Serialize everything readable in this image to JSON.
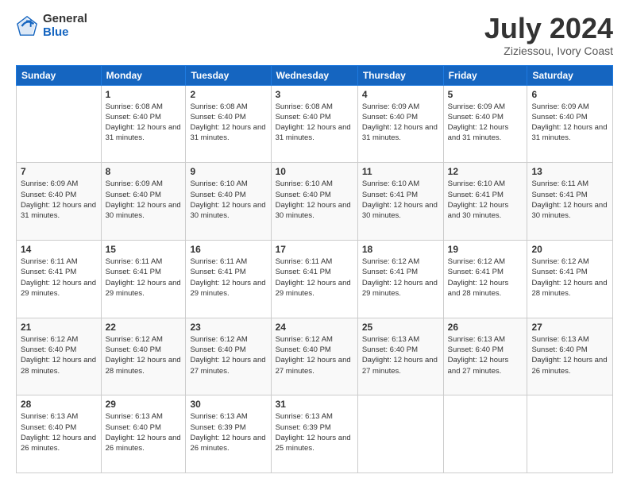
{
  "logo": {
    "general": "General",
    "blue": "Blue"
  },
  "title": {
    "month_year": "July 2024",
    "location": "Ziziessou, Ivory Coast"
  },
  "weekdays": [
    "Sunday",
    "Monday",
    "Tuesday",
    "Wednesday",
    "Thursday",
    "Friday",
    "Saturday"
  ],
  "weeks": [
    [
      {
        "day": "",
        "sunrise": "",
        "sunset": "",
        "daylight": ""
      },
      {
        "day": "1",
        "sunrise": "Sunrise: 6:08 AM",
        "sunset": "Sunset: 6:40 PM",
        "daylight": "Daylight: 12 hours and 31 minutes."
      },
      {
        "day": "2",
        "sunrise": "Sunrise: 6:08 AM",
        "sunset": "Sunset: 6:40 PM",
        "daylight": "Daylight: 12 hours and 31 minutes."
      },
      {
        "day": "3",
        "sunrise": "Sunrise: 6:08 AM",
        "sunset": "Sunset: 6:40 PM",
        "daylight": "Daylight: 12 hours and 31 minutes."
      },
      {
        "day": "4",
        "sunrise": "Sunrise: 6:09 AM",
        "sunset": "Sunset: 6:40 PM",
        "daylight": "Daylight: 12 hours and 31 minutes."
      },
      {
        "day": "5",
        "sunrise": "Sunrise: 6:09 AM",
        "sunset": "Sunset: 6:40 PM",
        "daylight": "Daylight: 12 hours and 31 minutes."
      },
      {
        "day": "6",
        "sunrise": "Sunrise: 6:09 AM",
        "sunset": "Sunset: 6:40 PM",
        "daylight": "Daylight: 12 hours and 31 minutes."
      }
    ],
    [
      {
        "day": "7",
        "sunrise": "Sunrise: 6:09 AM",
        "sunset": "Sunset: 6:40 PM",
        "daylight": "Daylight: 12 hours and 31 minutes."
      },
      {
        "day": "8",
        "sunrise": "Sunrise: 6:09 AM",
        "sunset": "Sunset: 6:40 PM",
        "daylight": "Daylight: 12 hours and 30 minutes."
      },
      {
        "day": "9",
        "sunrise": "Sunrise: 6:10 AM",
        "sunset": "Sunset: 6:40 PM",
        "daylight": "Daylight: 12 hours and 30 minutes."
      },
      {
        "day": "10",
        "sunrise": "Sunrise: 6:10 AM",
        "sunset": "Sunset: 6:40 PM",
        "daylight": "Daylight: 12 hours and 30 minutes."
      },
      {
        "day": "11",
        "sunrise": "Sunrise: 6:10 AM",
        "sunset": "Sunset: 6:41 PM",
        "daylight": "Daylight: 12 hours and 30 minutes."
      },
      {
        "day": "12",
        "sunrise": "Sunrise: 6:10 AM",
        "sunset": "Sunset: 6:41 PM",
        "daylight": "Daylight: 12 hours and 30 minutes."
      },
      {
        "day": "13",
        "sunrise": "Sunrise: 6:11 AM",
        "sunset": "Sunset: 6:41 PM",
        "daylight": "Daylight: 12 hours and 30 minutes."
      }
    ],
    [
      {
        "day": "14",
        "sunrise": "Sunrise: 6:11 AM",
        "sunset": "Sunset: 6:41 PM",
        "daylight": "Daylight: 12 hours and 29 minutes."
      },
      {
        "day": "15",
        "sunrise": "Sunrise: 6:11 AM",
        "sunset": "Sunset: 6:41 PM",
        "daylight": "Daylight: 12 hours and 29 minutes."
      },
      {
        "day": "16",
        "sunrise": "Sunrise: 6:11 AM",
        "sunset": "Sunset: 6:41 PM",
        "daylight": "Daylight: 12 hours and 29 minutes."
      },
      {
        "day": "17",
        "sunrise": "Sunrise: 6:11 AM",
        "sunset": "Sunset: 6:41 PM",
        "daylight": "Daylight: 12 hours and 29 minutes."
      },
      {
        "day": "18",
        "sunrise": "Sunrise: 6:12 AM",
        "sunset": "Sunset: 6:41 PM",
        "daylight": "Daylight: 12 hours and 29 minutes."
      },
      {
        "day": "19",
        "sunrise": "Sunrise: 6:12 AM",
        "sunset": "Sunset: 6:41 PM",
        "daylight": "Daylight: 12 hours and 28 minutes."
      },
      {
        "day": "20",
        "sunrise": "Sunrise: 6:12 AM",
        "sunset": "Sunset: 6:41 PM",
        "daylight": "Daylight: 12 hours and 28 minutes."
      }
    ],
    [
      {
        "day": "21",
        "sunrise": "Sunrise: 6:12 AM",
        "sunset": "Sunset: 6:40 PM",
        "daylight": "Daylight: 12 hours and 28 minutes."
      },
      {
        "day": "22",
        "sunrise": "Sunrise: 6:12 AM",
        "sunset": "Sunset: 6:40 PM",
        "daylight": "Daylight: 12 hours and 28 minutes."
      },
      {
        "day": "23",
        "sunrise": "Sunrise: 6:12 AM",
        "sunset": "Sunset: 6:40 PM",
        "daylight": "Daylight: 12 hours and 27 minutes."
      },
      {
        "day": "24",
        "sunrise": "Sunrise: 6:12 AM",
        "sunset": "Sunset: 6:40 PM",
        "daylight": "Daylight: 12 hours and 27 minutes."
      },
      {
        "day": "25",
        "sunrise": "Sunrise: 6:13 AM",
        "sunset": "Sunset: 6:40 PM",
        "daylight": "Daylight: 12 hours and 27 minutes."
      },
      {
        "day": "26",
        "sunrise": "Sunrise: 6:13 AM",
        "sunset": "Sunset: 6:40 PM",
        "daylight": "Daylight: 12 hours and 27 minutes."
      },
      {
        "day": "27",
        "sunrise": "Sunrise: 6:13 AM",
        "sunset": "Sunset: 6:40 PM",
        "daylight": "Daylight: 12 hours and 26 minutes."
      }
    ],
    [
      {
        "day": "28",
        "sunrise": "Sunrise: 6:13 AM",
        "sunset": "Sunset: 6:40 PM",
        "daylight": "Daylight: 12 hours and 26 minutes."
      },
      {
        "day": "29",
        "sunrise": "Sunrise: 6:13 AM",
        "sunset": "Sunset: 6:40 PM",
        "daylight": "Daylight: 12 hours and 26 minutes."
      },
      {
        "day": "30",
        "sunrise": "Sunrise: 6:13 AM",
        "sunset": "Sunset: 6:39 PM",
        "daylight": "Daylight: 12 hours and 26 minutes."
      },
      {
        "day": "31",
        "sunrise": "Sunrise: 6:13 AM",
        "sunset": "Sunset: 6:39 PM",
        "daylight": "Daylight: 12 hours and 25 minutes."
      },
      {
        "day": "",
        "sunrise": "",
        "sunset": "",
        "daylight": ""
      },
      {
        "day": "",
        "sunrise": "",
        "sunset": "",
        "daylight": ""
      },
      {
        "day": "",
        "sunrise": "",
        "sunset": "",
        "daylight": ""
      }
    ]
  ]
}
